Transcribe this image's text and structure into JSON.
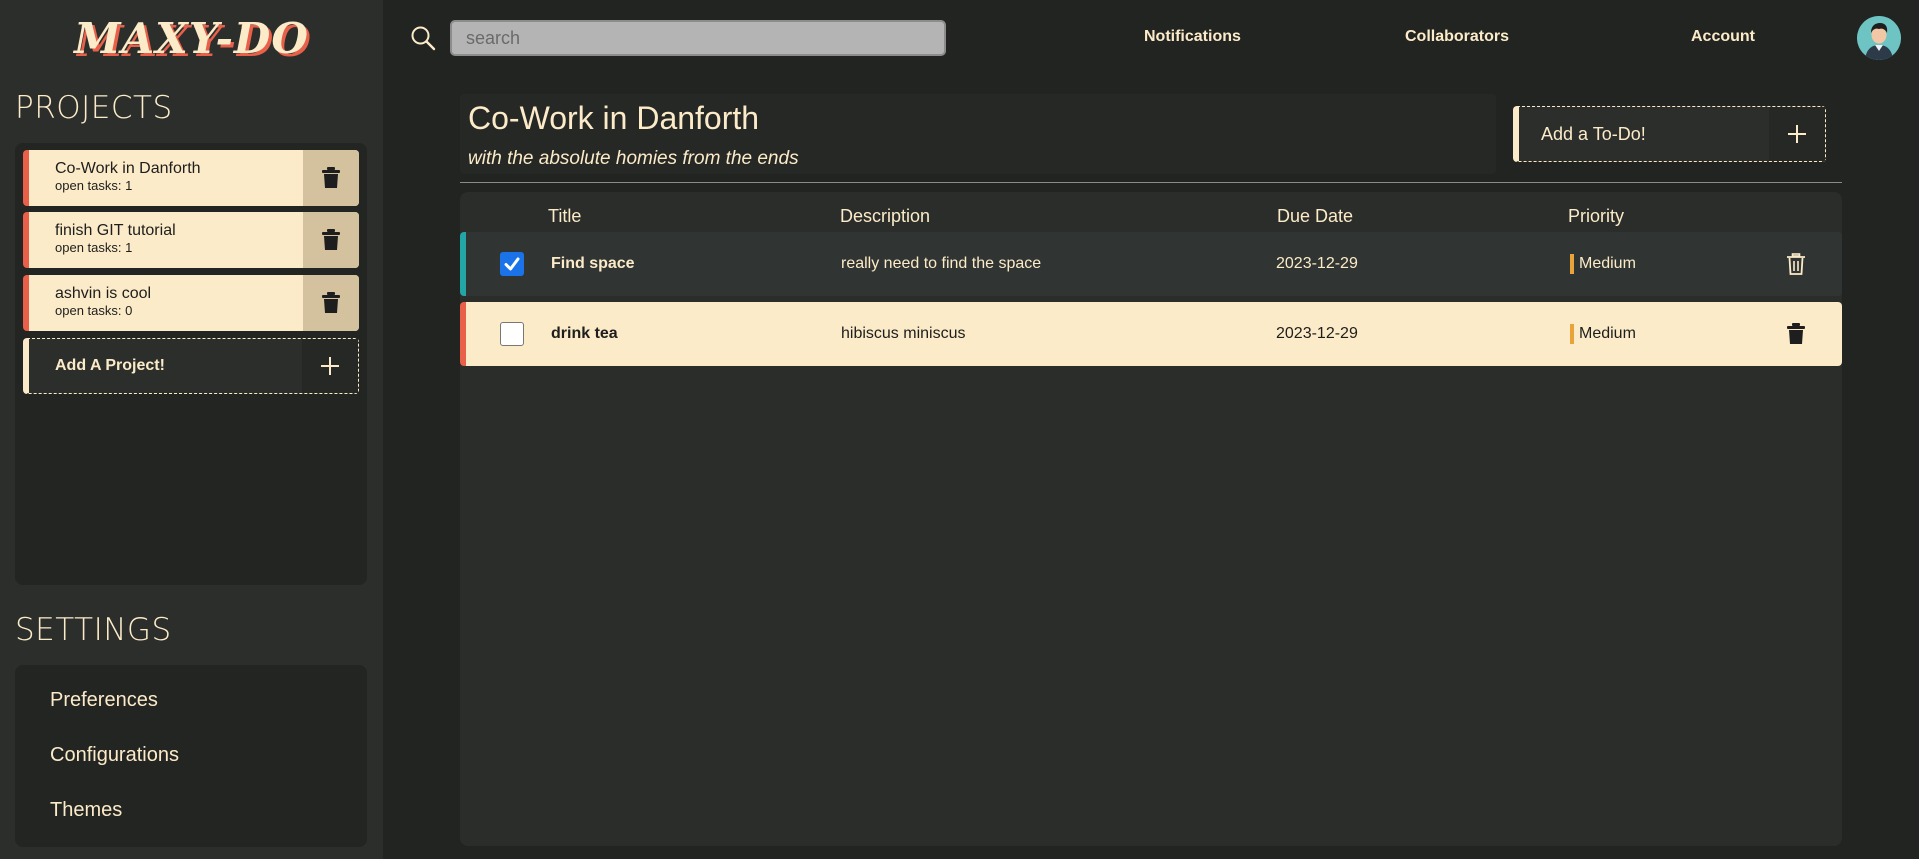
{
  "app": {
    "logo": "MAXY-DO"
  },
  "sidebar": {
    "projects_title": "PROJECTS",
    "projects": [
      {
        "name": "Co-Work in Danforth",
        "open_tasks": "open tasks: 1"
      },
      {
        "name": "finish GIT tutorial",
        "open_tasks": "open tasks: 1"
      },
      {
        "name": "ashvin is cool",
        "open_tasks": "open tasks: 0"
      }
    ],
    "add_project_label": "Add A Project!",
    "settings_title": "SETTINGS",
    "settings_items": [
      "Preferences",
      "Configurations",
      "Themes"
    ]
  },
  "header": {
    "search_placeholder": "search",
    "nav": [
      "Notifications",
      "Collaborators",
      "Account"
    ]
  },
  "main": {
    "project_title": "Co-Work in Danforth",
    "project_subtitle": "with the absolute homies from the ends",
    "add_todo_label": "Add a To-Do!",
    "columns": [
      "Title",
      "Description",
      "Due Date",
      "Priority"
    ],
    "tasks": [
      {
        "title": "Find space",
        "description": "really need to find the space",
        "due": "2023-12-29",
        "priority": "Medium",
        "done": true
      },
      {
        "title": "drink tea",
        "description": "hibiscus miniscus",
        "due": "2023-12-29",
        "priority": "Medium",
        "done": false
      }
    ]
  },
  "colors": {
    "background": "#222422",
    "accent_cream": "#fcebc8",
    "accent_red": "#e8604a",
    "accent_teal": "#22a6a6",
    "priority_medium": "#e8a33a",
    "checkbox_blue": "#1a73e8"
  },
  "icons": [
    "search-icon",
    "trash-icon",
    "plus-icon",
    "avatar",
    "checkmark-icon"
  ]
}
